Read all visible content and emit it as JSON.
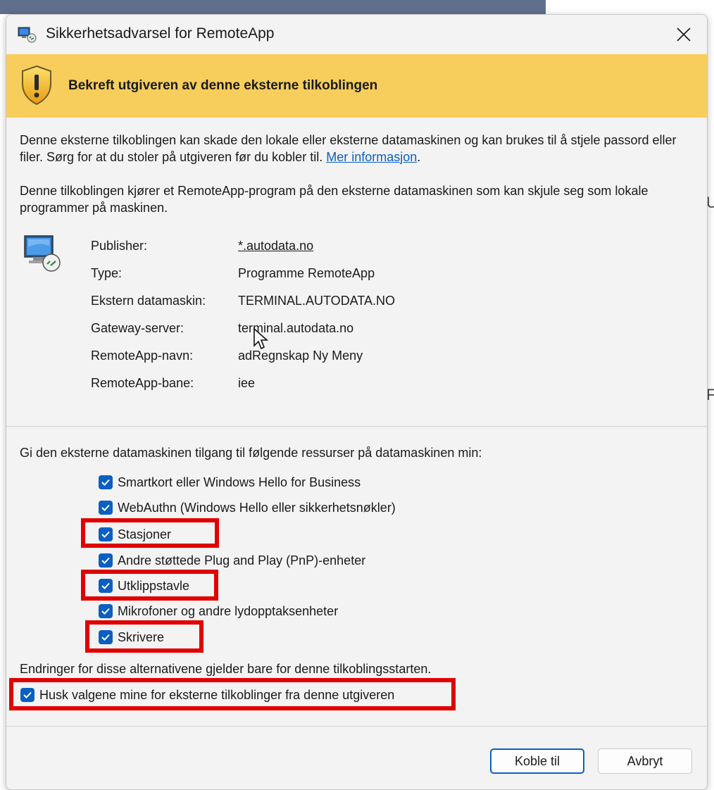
{
  "window": {
    "title": "Sikkerhetsadvarsel for RemoteApp",
    "close_glyph": "✕"
  },
  "banner": {
    "text": "Bekreft utgiveren av denne eksterne tilkoblingen",
    "icon": "warning-shield-icon"
  },
  "intro": {
    "warning_text": "Denne eksterne tilkoblingen kan skade den lokale eller eksterne datamaskinen og kan brukes til å stjele passord eller filer. Sørg for at du stoler på utgiveren før du kobler til.",
    "more_info_link": "Mer informasjon",
    "more_info_suffix": ".",
    "program_text": "Denne tilkoblingen kjører et RemoteApp-program på den eksterne datamaskinen som kan skjule seg som lokale programmer på maskinen."
  },
  "details": [
    {
      "label": "Publisher:",
      "value": "*.autodata.no",
      "is_link": true
    },
    {
      "label": "Type:",
      "value": "Programme RemoteApp",
      "is_link": false
    },
    {
      "label": "Ekstern datamaskin:",
      "value": "TERMINAL.AUTODATA.NO",
      "is_link": false
    },
    {
      "label": "Gateway-server:",
      "value": "terminal.autodata.no",
      "is_link": false
    },
    {
      "label": "RemoteApp-navn:",
      "value": "adRegnskap Ny Meny",
      "is_link": false
    },
    {
      "label": "RemoteApp-bane:",
      "value": "iee",
      "is_link": false
    }
  ],
  "resources": {
    "heading": "Gi den eksterne datamaskinen tilgang til følgende ressurser på datamaskinen min:",
    "items": [
      {
        "label": "Smartkort eller Windows Hello for Business",
        "checked": true,
        "highlighted": false
      },
      {
        "label": "WebAuthn (Windows Hello eller sikkerhetsnøkler)",
        "checked": true,
        "highlighted": false
      },
      {
        "label": "Stasjoner",
        "checked": true,
        "highlighted": true
      },
      {
        "label": "Andre støttede Plug and Play (PnP)-enheter",
        "checked": true,
        "highlighted": false
      },
      {
        "label": "Utklippstavle",
        "checked": true,
        "highlighted": true
      },
      {
        "label": "Mikrofoner og andre lydopptaksenheter",
        "checked": true,
        "highlighted": false
      },
      {
        "label": "Skrivere",
        "checked": true,
        "highlighted": true
      }
    ],
    "note": "Endringer for disse alternativene gjelder bare for denne tilkoblingsstarten.",
    "remember": {
      "label": "Husk valgene mine for eksterne tilkoblinger fra denne utgiveren",
      "checked": true,
      "highlighted": true
    }
  },
  "buttons": {
    "connect": "Koble til",
    "cancel": "Avbryt"
  },
  "colors": {
    "accent": "#0a5fc2",
    "banner": "#f7cd5c",
    "highlight": "#e00000"
  }
}
